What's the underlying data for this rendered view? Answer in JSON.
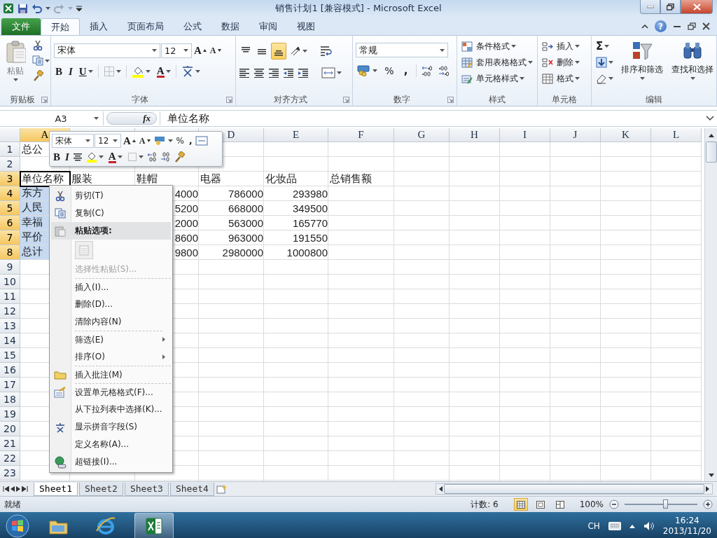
{
  "window": {
    "title": "销售计划1  [兼容模式]  -  Microsoft Excel"
  },
  "tabs": [
    {
      "label": "文件",
      "kind": "file",
      "selected": false
    },
    {
      "label": "开始",
      "kind": "tab",
      "selected": true
    },
    {
      "label": "插入",
      "kind": "tab",
      "selected": false
    },
    {
      "label": "页面布局",
      "kind": "tab",
      "selected": false
    },
    {
      "label": "公式",
      "kind": "tab",
      "selected": false
    },
    {
      "label": "数据",
      "kind": "tab",
      "selected": false
    },
    {
      "label": "审阅",
      "kind": "tab",
      "selected": false
    },
    {
      "label": "视图",
      "kind": "tab",
      "selected": false
    }
  ],
  "help": "?",
  "ribbon": {
    "clipboard": {
      "label": "剪贴板",
      "paste": "粘贴"
    },
    "font": {
      "label": "字体",
      "name": "宋体",
      "size": "12",
      "grow": "A",
      "shrink": "A",
      "bold": "B",
      "italic": "I",
      "underline": "U",
      "color_letter": "A"
    },
    "alignment": {
      "label": "对齐方式",
      "vertical": [
        {
          "selected": false
        },
        {
          "selected": false
        },
        {
          "selected": true
        }
      ]
    },
    "number": {
      "label": "数字",
      "format": "常规",
      "percent": "%",
      "comma": ","
    },
    "styles": {
      "label": "样式",
      "items": [
        "条件格式",
        "套用表格格式",
        "单元格样式"
      ]
    },
    "cells": {
      "label": "单元格",
      "items": [
        "插入",
        "删除",
        "格式"
      ]
    },
    "editing": {
      "label": "编辑",
      "sum": "Σ",
      "items": [
        "排序和筛选",
        "查找和选择"
      ]
    }
  },
  "formula_bar": {
    "name_box": "A3",
    "fx": "fx",
    "formula": "单位名称"
  },
  "sheet": {
    "columns": [
      {
        "label": "A",
        "selected": true
      },
      {
        "selected": false
      },
      {
        "selected": false
      },
      {
        "label": "D",
        "selected": false
      },
      {
        "label": "E",
        "selected": false
      },
      {
        "label": "F",
        "selected": false
      },
      {
        "label": "G",
        "selected": false
      },
      {
        "label": "H",
        "selected": false
      },
      {
        "label": "I",
        "selected": false
      },
      {
        "label": "J",
        "selected": false
      },
      {
        "label": "K",
        "selected": false
      },
      {
        "label": "L",
        "selected": false
      }
    ],
    "rows": [
      {
        "header": "1",
        "selected": false,
        "active": false,
        "kind": "text",
        "cells": [
          "总公"
        ]
      },
      {
        "header": "2",
        "selected": false,
        "active": false,
        "kind": "text"
      },
      {
        "header": "3",
        "selected": true,
        "active": true,
        "kind": "text",
        "cells": [
          "单位名称",
          "服装",
          "鞋帽",
          "电器",
          "化妆品",
          "总销售额"
        ]
      },
      {
        "header": "4",
        "selected": true,
        "active": false,
        "kind": "numbers",
        "cells": [
          "东方",
          null,
          "4000",
          "786000",
          "293980"
        ]
      },
      {
        "header": "5",
        "selected": true,
        "active": false,
        "kind": "numbers",
        "cells": [
          "人民",
          null,
          "5200",
          "668000",
          "349500"
        ]
      },
      {
        "header": "6",
        "selected": true,
        "active": false,
        "kind": "numbers",
        "cells": [
          "幸福",
          null,
          "2000",
          "563000",
          "165770"
        ]
      },
      {
        "header": "7",
        "selected": true,
        "active": false,
        "kind": "numbers",
        "cells": [
          "平价",
          null,
          "8600",
          "963000",
          "191550"
        ]
      },
      {
        "header": "8",
        "selected": true,
        "active": false,
        "kind": "numbers",
        "cells": [
          "总计",
          null,
          "9800",
          "2980000",
          "1000800"
        ]
      },
      {
        "header": "9",
        "selected": false,
        "active": false,
        "kind": "text"
      },
      {
        "header": "10",
        "selected": false,
        "active": false,
        "kind": "text"
      },
      {
        "header": "11",
        "selected": false,
        "active": false,
        "kind": "text"
      },
      {
        "header": "12",
        "selected": false,
        "active": false,
        "kind": "text"
      },
      {
        "header": "13",
        "selected": false,
        "active": false,
        "kind": "text"
      },
      {
        "header": "14",
        "selected": false,
        "active": false,
        "kind": "text"
      },
      {
        "header": "15",
        "selected": false,
        "active": false,
        "kind": "text"
      },
      {
        "header": "16",
        "selected": false,
        "active": false,
        "kind": "text"
      },
      {
        "header": "17",
        "selected": false,
        "active": false,
        "kind": "text"
      },
      {
        "header": "18",
        "selected": false,
        "active": false,
        "kind": "text"
      },
      {
        "header": "19",
        "selected": false,
        "active": false,
        "kind": "text"
      },
      {
        "header": "20",
        "selected": false,
        "active": false,
        "kind": "text"
      },
      {
        "header": "21",
        "selected": false,
        "active": false,
        "kind": "text"
      },
      {
        "header": "22",
        "selected": false,
        "active": false,
        "kind": "text"
      },
      {
        "header": "23",
        "selected": false,
        "active": false,
        "kind": "text"
      }
    ]
  },
  "mini_toolbar": {
    "font": "宋体",
    "size": "12",
    "grow": "A",
    "shrink": "A",
    "percent": "%",
    "comma": ",",
    "bold": "B",
    "italic": "I",
    "color_letter": "A"
  },
  "context_menu": [
    {
      "kind": "item",
      "label": "剪切(T)",
      "disabled": false,
      "separator_before": false
    },
    {
      "kind": "item",
      "label": "复制(C)",
      "disabled": false,
      "separator_before": false
    },
    {
      "kind": "heading",
      "label": "粘贴选项:",
      "disabled": false,
      "separator_before": false
    },
    {
      "kind": "paste-option",
      "disabled": false,
      "separator_before": false
    },
    {
      "kind": "item",
      "label": "选择性粘贴(S)...",
      "disabled": true,
      "separator_before": false
    },
    {
      "kind": "item",
      "label": "插入(I)...",
      "disabled": false,
      "separator_before": true
    },
    {
      "kind": "item",
      "label": "删除(D)...",
      "disabled": false,
      "separator_before": false
    },
    {
      "kind": "item",
      "label": "清除内容(N)",
      "disabled": false,
      "separator_before": false
    },
    {
      "kind": "submenu",
      "label": "筛选(E)",
      "disabled": false,
      "separator_before": true
    },
    {
      "kind": "submenu",
      "label": "排序(O)",
      "disabled": false,
      "separator_before": false
    },
    {
      "kind": "item",
      "label": "插入批注(M)",
      "disabled": false,
      "separator_before": true
    },
    {
      "kind": "item",
      "label": "设置单元格格式(F)...",
      "disabled": false,
      "separator_before": true
    },
    {
      "kind": "item",
      "label": "从下拉列表中选择(K)...",
      "disabled": false,
      "separator_before": false
    },
    {
      "kind": "item",
      "label": "显示拼音字段(S)",
      "disabled": false,
      "separator_before": false
    },
    {
      "kind": "item",
      "label": "定义名称(A)...",
      "disabled": false,
      "separator_before": false
    },
    {
      "kind": "item",
      "label": "超链接(I)...",
      "disabled": false,
      "separator_before": false
    }
  ],
  "sheet_tabs": [
    {
      "label": "Sheet1",
      "selected": true
    },
    {
      "label": "Sheet2",
      "selected": false
    },
    {
      "label": "Sheet3",
      "selected": false
    },
    {
      "label": "Sheet4",
      "selected": false
    }
  ],
  "status_bar": {
    "ready": "就绪",
    "count": "计数: 6",
    "views": [
      {
        "selected": true
      },
      {
        "selected": false
      },
      {
        "selected": false
      }
    ],
    "zoom": "100%",
    "zoom_slider": {
      "level": 0.56
    }
  },
  "taskbar": {
    "apps": [
      {
        "selected": false
      },
      {
        "selected": false
      },
      {
        "selected": true
      }
    ],
    "language": "CH",
    "time": "16:24",
    "date": "2013/11/20"
  }
}
